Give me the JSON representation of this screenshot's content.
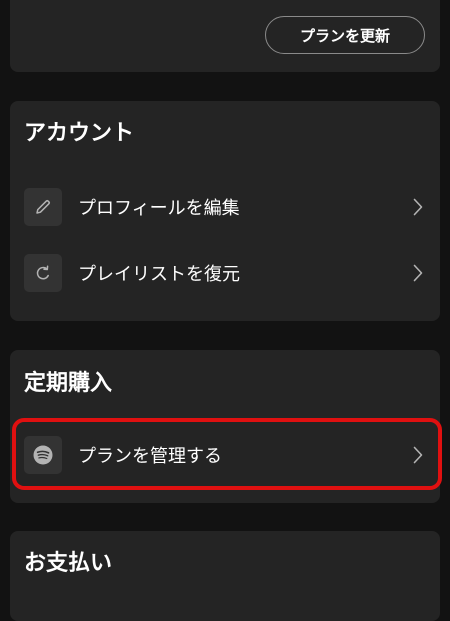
{
  "top_card": {
    "update_plan_label": "プランを更新"
  },
  "account": {
    "title": "アカウント",
    "items": [
      {
        "label": "プロフィールを編集",
        "icon": "pencil-icon"
      },
      {
        "label": "プレイリストを復元",
        "icon": "restore-icon"
      }
    ]
  },
  "subscription": {
    "title": "定期購入",
    "items": [
      {
        "label": "プランを管理する",
        "icon": "spotify-icon"
      }
    ]
  },
  "payment": {
    "title": "お支払い"
  },
  "colors": {
    "background": "#121212",
    "card": "#242424",
    "icon_tile": "#333333",
    "highlight": "#e01010"
  }
}
